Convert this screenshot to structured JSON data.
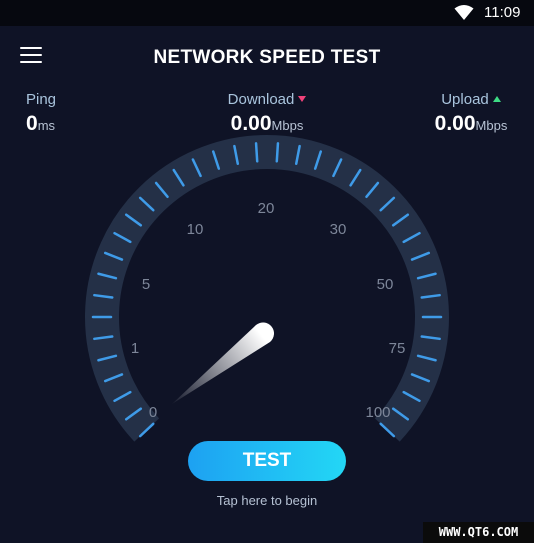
{
  "status_bar": {
    "time": "11:09",
    "wifi_icon": "wifi-icon"
  },
  "header": {
    "title": "NETWORK SPEED TEST",
    "menu_icon": "hamburger-menu-icon"
  },
  "metrics": {
    "ping": {
      "label": "Ping",
      "value": "0",
      "unit": "ms"
    },
    "download": {
      "label": "Download",
      "value": "0.00",
      "unit": "Mbps",
      "indicator": "arrow-down-icon",
      "indicator_color": "#f0427a"
    },
    "upload": {
      "label": "Upload",
      "value": "0.00",
      "unit": "Mbps",
      "indicator": "arrow-up-icon",
      "indicator_color": "#3ddc84"
    }
  },
  "gauge": {
    "scale_labels": [
      "0",
      "1",
      "5",
      "10",
      "20",
      "30",
      "50",
      "75",
      "100"
    ],
    "needle_value": 0,
    "track_color": "#243047",
    "tick_color": "#3f9be8"
  },
  "action": {
    "button_label": "TEST",
    "hint": "Tap here to begin"
  },
  "watermark": "WWW.QT6.COM",
  "colors": {
    "background": "#0f1326",
    "button_start": "#1da1f2",
    "button_end": "#23d7f5"
  }
}
